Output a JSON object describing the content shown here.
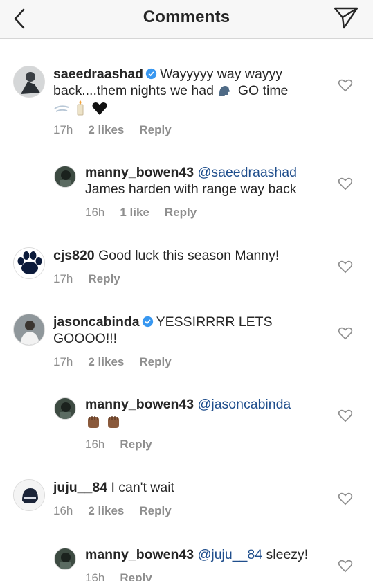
{
  "header": {
    "title": "Comments"
  },
  "comments": [
    {
      "username": "saeedraashad",
      "text_a": "Wayyyyy way wayyy",
      "text_b": "back....them nights we had",
      "text_c": "GO time",
      "time": "17h",
      "likes": "2 likes",
      "reply": "Reply"
    },
    {
      "username": "manny_bowen43",
      "mention": "@saeedraashad",
      "text": "James harden with range way back",
      "time": "16h",
      "likes": "1 like",
      "reply": "Reply"
    },
    {
      "username": "cjs820",
      "text": "Good luck this season Manny!",
      "time": "17h",
      "reply": "Reply"
    },
    {
      "username": "jasoncabinda",
      "text_a": "YESSIRRRR LETS",
      "text_b": "GOOOO!!!",
      "time": "17h",
      "likes": "2 likes",
      "reply": "Reply"
    },
    {
      "username": "manny_bowen43",
      "mention": "@jasoncabinda",
      "time": "16h",
      "reply": "Reply"
    },
    {
      "username": "juju__84",
      "text": "I can't wait",
      "time": "16h",
      "likes": "2 likes",
      "reply": "Reply"
    },
    {
      "username": "manny_bowen43",
      "mention": "@juju__84",
      "text": "sleezy!",
      "time": "16h",
      "reply": "Reply"
    }
  ],
  "colors": {
    "verified": "#3897f0",
    "mention": "#1f4e8c",
    "meta": "#8e8e8e"
  }
}
